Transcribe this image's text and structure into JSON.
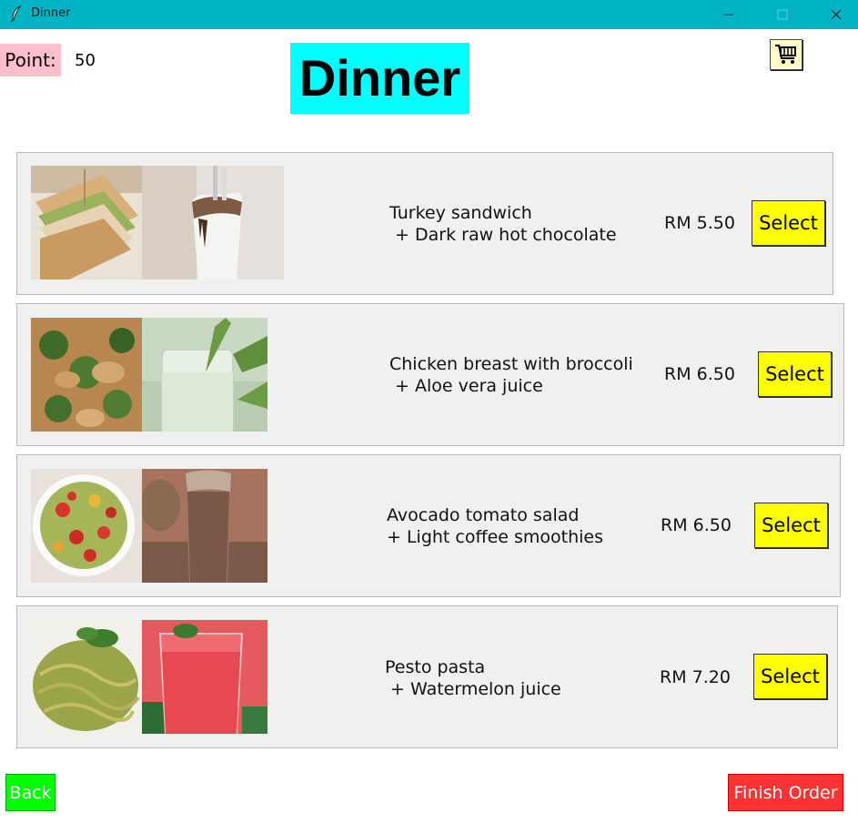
{
  "window": {
    "title": "Dinner"
  },
  "header": {
    "point_label": "Point:",
    "point_value": "50",
    "title": "Dinner",
    "cart_icon": "shopping-cart-icon"
  },
  "menu": [
    {
      "name": "Turkey sandwich\n + Dark raw hot chocolate",
      "price": "RM 5.50",
      "select": "Select"
    },
    {
      "name": "Chicken breast with broccoli\n + Aloe vera juice",
      "price": "RM 6.50",
      "select": "Select"
    },
    {
      "name": "Avocado tomato salad\n+ Light coffee smoothies",
      "price": "RM 6.50",
      "select": "Select"
    },
    {
      "name": "Pesto pasta\n + Watermelon juice",
      "price": "RM 7.20",
      "select": "Select"
    }
  ],
  "footer": {
    "back": "Back",
    "finish": "Finish Order"
  },
  "colors": {
    "titlebar": "#00b4c5",
    "point_label_bg": "#ffc0cb",
    "title_bg": "#00ffff",
    "select_bg": "#ffff00",
    "back_bg": "#00ff00",
    "finish_bg": "#ff3333"
  }
}
